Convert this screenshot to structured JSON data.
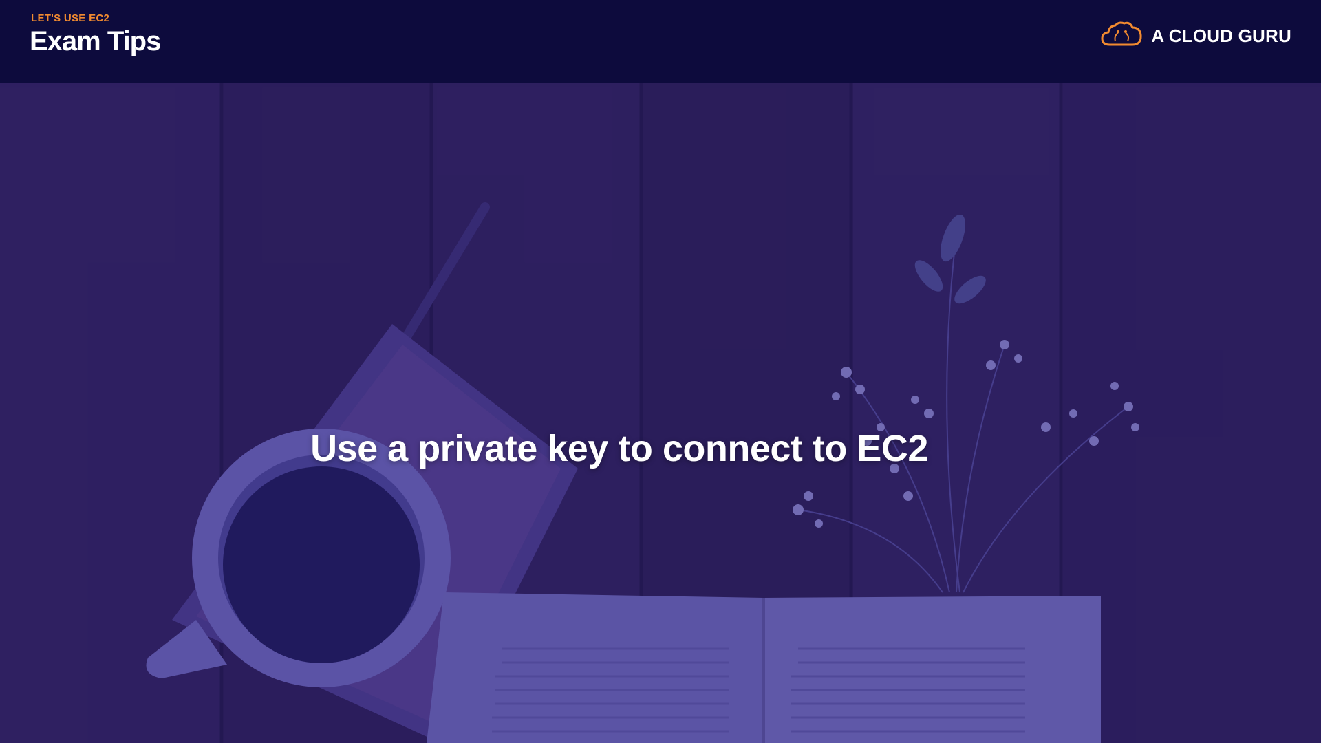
{
  "header": {
    "kicker": "LET'S USE EC2",
    "title": "Exam Tips",
    "brand": {
      "name": "A CLOUD GURU",
      "logo_icon": "cloud-logo-icon",
      "logo_color": "#f28b30"
    }
  },
  "slide": {
    "headline": "Use a private key to connect to EC2"
  },
  "colors": {
    "background": "#0d0b3d",
    "accent": "#f28b30",
    "text": "#ffffff"
  }
}
